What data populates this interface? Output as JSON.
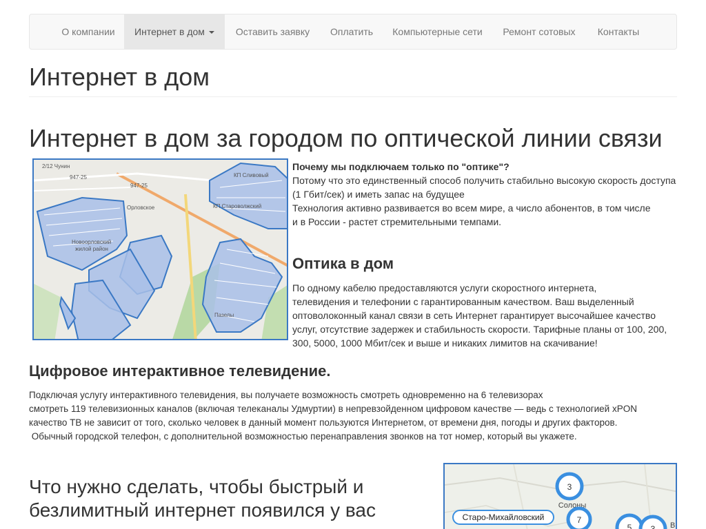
{
  "nav": {
    "items": [
      {
        "label": "О компании"
      },
      {
        "label": "Интернет в дом"
      },
      {
        "label": "Оставить заявку"
      },
      {
        "label": "Оплатить"
      },
      {
        "label": "Компьютерные сети"
      },
      {
        "label": "Ремонт сотовых"
      },
      {
        "label": "Контакты"
      }
    ],
    "active_index": 1
  },
  "page": {
    "title": "Интернет в дом",
    "section_title": "Интернет в дом за городом по оптической линии связи"
  },
  "why": {
    "title": "Почему мы подключаем только по \"оптике\"?",
    "lines": [
      "Потому что это единственный способ получить стабильно высокую скорость доступа",
      "(1 Гбит/сек) и иметь запас на будущее",
      "Технология активно развивается во всем мире, а число абонентов, в том числе",
      "и в России - растет стремительными темпами."
    ]
  },
  "optics": {
    "title": "Оптика в дом",
    "lines": [
      "По одному кабелю предоставляются услуги скоростного интернета,",
      "телевидения и телефонии с гарантированным качеством. Ваш выделенный",
      "оптоволоконный канал связи в сеть Интернет гарантирует высочайшее качество",
      "услуг, отсутствие задержек и стабильность скорости. Тарифные планы от 100, 200,",
      "300, 5000, 1000 Мбит/сек и выше и никаких лимитов на скачивание!"
    ]
  },
  "tv": {
    "title": "Цифровое интерактивное телевидение.",
    "lines": [
      "Подключая услугу интерактивного телевидения, вы получаете возможность смотреть одновременно на 6 телевизорах",
      "смотреть 119 телевизионных каналов (включая телеканалы Удмуртии) в непревзойденном цифровом качестве — ведь с технологией xPON",
      "качество ТВ не зависит от того, сколько человек в данный момент пользуются Интернетом, от времени дня, погоды и других факторов.",
      " Обычный городской телефон, с дополнительной возможностью перенаправления звонков на тот номер, который вы укажете."
    ]
  },
  "bottom": {
    "title_line1": "Что нужно сделать, чтобы быстрый и",
    "title_line2": "безлимитный интернет появился у вас"
  },
  "map1": {
    "labels": [
      "Орловское",
      "Новоорловский жилой район",
      "Пазелы",
      "КП Сливовый",
      "КП Староволжский",
      "2/12 Чунин",
      "947-25",
      "947-25"
    ],
    "accent": "#3a78c4",
    "fill": "#a9c0e8"
  },
  "map2": {
    "town_label": "Старо-Михайловский",
    "village_label": "Солоны",
    "clusters": [
      "3",
      "7",
      "5",
      "3"
    ],
    "edge_label": "В"
  }
}
